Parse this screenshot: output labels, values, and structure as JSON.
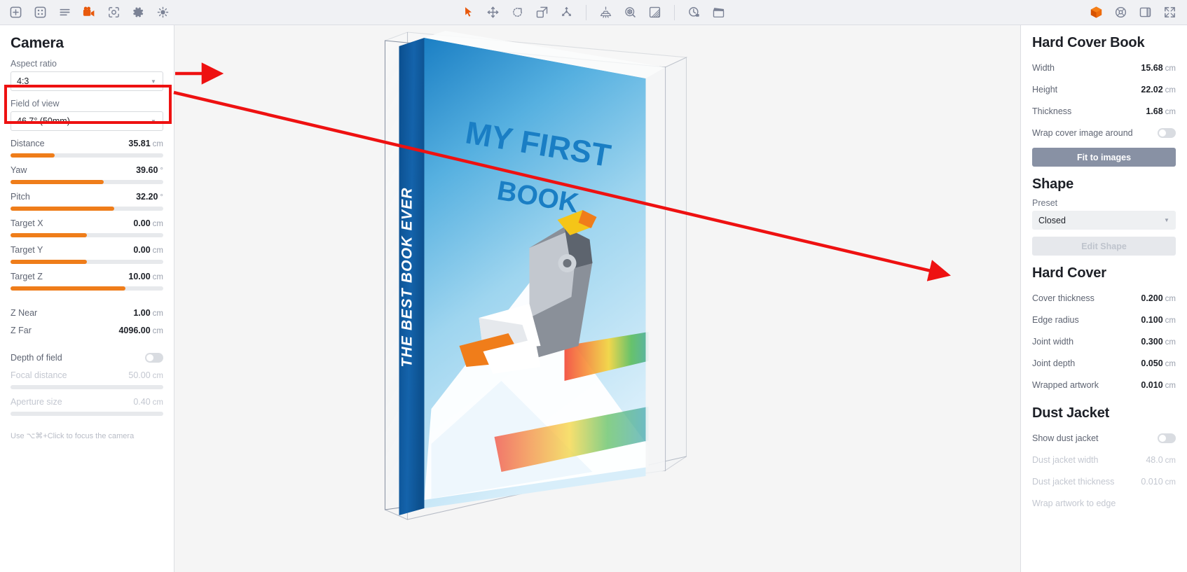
{
  "toolbar": {
    "left": [
      {
        "name": "add-icon",
        "label": "Add"
      },
      {
        "name": "grid-icon",
        "label": "Scene"
      },
      {
        "name": "list-icon",
        "label": "Layers"
      },
      {
        "name": "camera-video-icon",
        "label": "Camera"
      },
      {
        "name": "focus-icon",
        "label": "Focus"
      },
      {
        "name": "gear-icon",
        "label": "Settings"
      },
      {
        "name": "light-bulb-icon",
        "label": "Lighting"
      }
    ],
    "center": [
      {
        "name": "cursor-select-icon",
        "label": "Select"
      },
      {
        "name": "move-icon",
        "label": "Move"
      },
      {
        "name": "rotate-icon",
        "label": "Rotate"
      },
      {
        "name": "scale-icon",
        "label": "Scale"
      },
      {
        "name": "distribute-icon",
        "label": "Distribute"
      },
      {
        "name": "light-source-icon",
        "label": "Light"
      },
      {
        "name": "environment-icon",
        "label": "Environment"
      },
      {
        "name": "gradient-icon",
        "label": "Backdrop"
      },
      {
        "name": "history-icon",
        "label": "History"
      },
      {
        "name": "film-clapper-icon",
        "label": "Animation"
      }
    ],
    "right": [
      {
        "name": "cube-3d-icon",
        "label": "3D View"
      },
      {
        "name": "render-icon",
        "label": "Render"
      },
      {
        "name": "panel-toggle-icon",
        "label": "Toggle Panel"
      },
      {
        "name": "fullscreen-icon",
        "label": "Fullscreen"
      }
    ]
  },
  "camera": {
    "title": "Camera",
    "aspect_ratio": {
      "label": "Aspect ratio",
      "value": "4:3"
    },
    "field_of_view": {
      "label": "Field of view",
      "value": "46.7° (50mm)"
    },
    "sliders": [
      {
        "label": "Distance",
        "value": "35.81",
        "unit": "cm",
        "pct": 29,
        "dim": false
      },
      {
        "label": "Yaw",
        "value": "39.60",
        "unit": "°",
        "pct": 61,
        "dim": false
      },
      {
        "label": "Pitch",
        "value": "32.20",
        "unit": "°",
        "pct": 68,
        "dim": false
      },
      {
        "label": "Target X",
        "value": "0.00",
        "unit": "cm",
        "pct": 50,
        "dim": false
      },
      {
        "label": "Target Y",
        "value": "0.00",
        "unit": "cm",
        "pct": 50,
        "dim": false
      },
      {
        "label": "Target Z",
        "value": "10.00",
        "unit": "cm",
        "pct": 75,
        "dim": false
      }
    ],
    "z_near": {
      "label": "Z Near",
      "value": "1.00",
      "unit": "cm"
    },
    "z_far": {
      "label": "Z Far",
      "value": "4096.00",
      "unit": "cm"
    },
    "depth_of_field": {
      "label": "Depth of field",
      "enabled": false
    },
    "focal_distance": {
      "label": "Focal distance",
      "value": "50.00",
      "unit": "cm",
      "pct": 0
    },
    "aperture_size": {
      "label": "Aperture size",
      "value": "0.40",
      "unit": "cm",
      "pct": 0
    },
    "hint": "Use ⌥⌘+Click to focus the camera"
  },
  "inspector": {
    "hard_cover_book": {
      "title": "Hard Cover Book",
      "rows": [
        {
          "label": "Width",
          "value": "15.68",
          "unit": "cm"
        },
        {
          "label": "Height",
          "value": "22.02",
          "unit": "cm"
        },
        {
          "label": "Thickness",
          "value": "1.68",
          "unit": "cm"
        }
      ],
      "wrap_cover": {
        "label": "Wrap cover image around",
        "enabled": false
      },
      "fit_button": "Fit to images"
    },
    "shape": {
      "title": "Shape",
      "preset_label": "Preset",
      "preset_value": "Closed",
      "edit_button": "Edit Shape"
    },
    "hard_cover": {
      "title": "Hard Cover",
      "rows": [
        {
          "label": "Cover thickness",
          "value": "0.200",
          "unit": "cm"
        },
        {
          "label": "Edge radius",
          "value": "0.100",
          "unit": "cm"
        },
        {
          "label": "Joint width",
          "value": "0.300",
          "unit": "cm"
        },
        {
          "label": "Joint depth",
          "value": "0.050",
          "unit": "cm"
        },
        {
          "label": "Wrapped artwork",
          "value": "0.010",
          "unit": "cm"
        }
      ]
    },
    "dust_jacket": {
      "title": "Dust Jacket",
      "show": {
        "label": "Show dust jacket",
        "enabled": false
      },
      "rows": [
        {
          "label": "Dust jacket width",
          "value": "48.0",
          "unit": "cm"
        },
        {
          "label": "Dust jacket thickness",
          "value": "0.010",
          "unit": "cm"
        },
        {
          "label": "Wrap artwork to edge",
          "value": "",
          "unit": ""
        }
      ]
    }
  },
  "book": {
    "cover_title_line1": "MY FIRST",
    "cover_title_line2": "BOOK",
    "spine_text": "THE BEST BOOK EVER"
  },
  "colors": {
    "accent": "#ef7d1a",
    "annotation_red": "#ee1111",
    "toolbar_bg": "#f0f1f4",
    "panel_bg": "#ffffff",
    "viewport_bg": "#f5f5f5"
  }
}
